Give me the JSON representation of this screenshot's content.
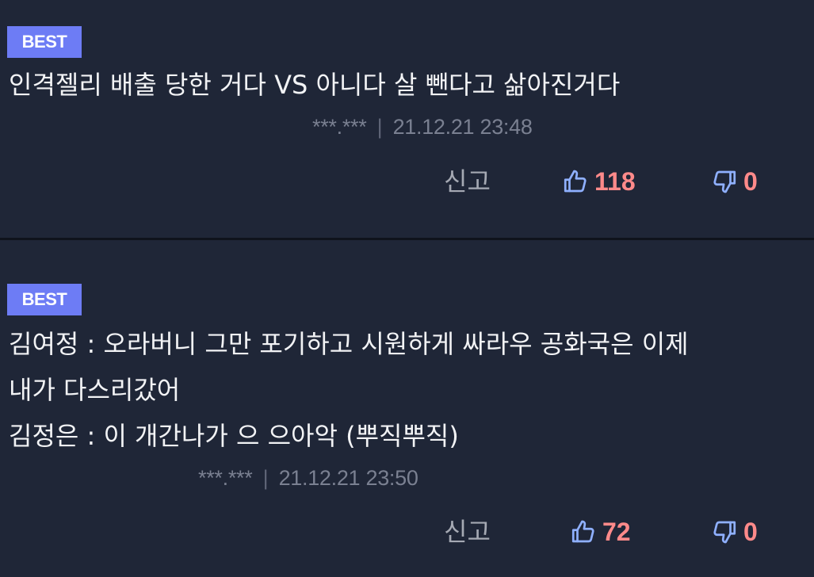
{
  "comments": [
    {
      "badge": "BEST",
      "lines": [
        "인격젤리 배출 당한 거다 VS 아니다 살 뺀다고 삶아진거다"
      ],
      "ip": "***.***",
      "separator": "|",
      "datetime": "21.12.21 23:48",
      "report_label": "신고",
      "likes": "118",
      "dislikes": "0"
    },
    {
      "badge": "BEST",
      "lines": [
        "김여정 : 오라버니 그만 포기하고 시원하게 싸라우 공화국은 이제",
        "내가 다스리갔어",
        "김정은 : 이 개간나가 으 으아악 (뿌직뿌직)"
      ],
      "ip": "***.***",
      "separator": "|",
      "datetime": "21.12.21 23:50",
      "report_label": "신고",
      "likes": "72",
      "dislikes": "0"
    }
  ],
  "icons": {
    "like": "thumbs-up-icon",
    "dislike": "thumbs-down-icon"
  },
  "colors": {
    "background": "#1f2637",
    "badge": "#6d7cf5",
    "like_icon": "#8fb0ff",
    "count": "#ff8a8a"
  }
}
